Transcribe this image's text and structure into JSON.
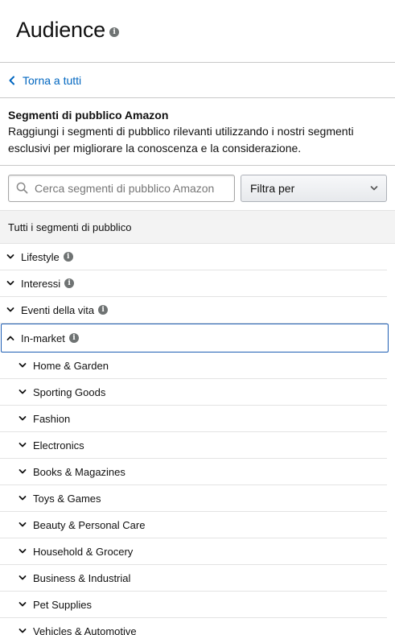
{
  "header": {
    "title": "Audience",
    "info_icon": "info-icon"
  },
  "back_link": {
    "label": "Torna a tutti",
    "icon": "chevron-left-icon"
  },
  "section": {
    "title": "Segmenti di pubblico Amazon",
    "description": "Raggiungi i segmenti di pubblico rilevanti utilizzando i nostri segmenti esclusivi per migliorare la conoscenza e la considerazione."
  },
  "search": {
    "placeholder": "Cerca segmenti di pubblico Amazon",
    "value": "",
    "icon": "search-icon"
  },
  "filter": {
    "label": "Filtra per",
    "icon": "chevron-down-icon"
  },
  "all_segments_label": "Tutti i segmenti di pubblico",
  "categories": [
    {
      "label": "Lifestyle",
      "expanded": false
    },
    {
      "label": "Interessi",
      "expanded": false
    },
    {
      "label": "Eventi della vita",
      "expanded": false
    },
    {
      "label": "In-market",
      "expanded": true
    }
  ],
  "in_market_subcategories": [
    "Home & Garden",
    "Sporting Goods",
    "Fashion",
    "Electronics",
    "Books & Magazines",
    "Toys & Games",
    "Beauty & Personal Care",
    "Household & Grocery",
    "Business & Industrial",
    "Pet Supplies",
    "Vehicles & Automotive"
  ],
  "colors": {
    "link": "#0066c0",
    "focus_border": "#1f5fb4",
    "info_icon": "#6f7373"
  }
}
